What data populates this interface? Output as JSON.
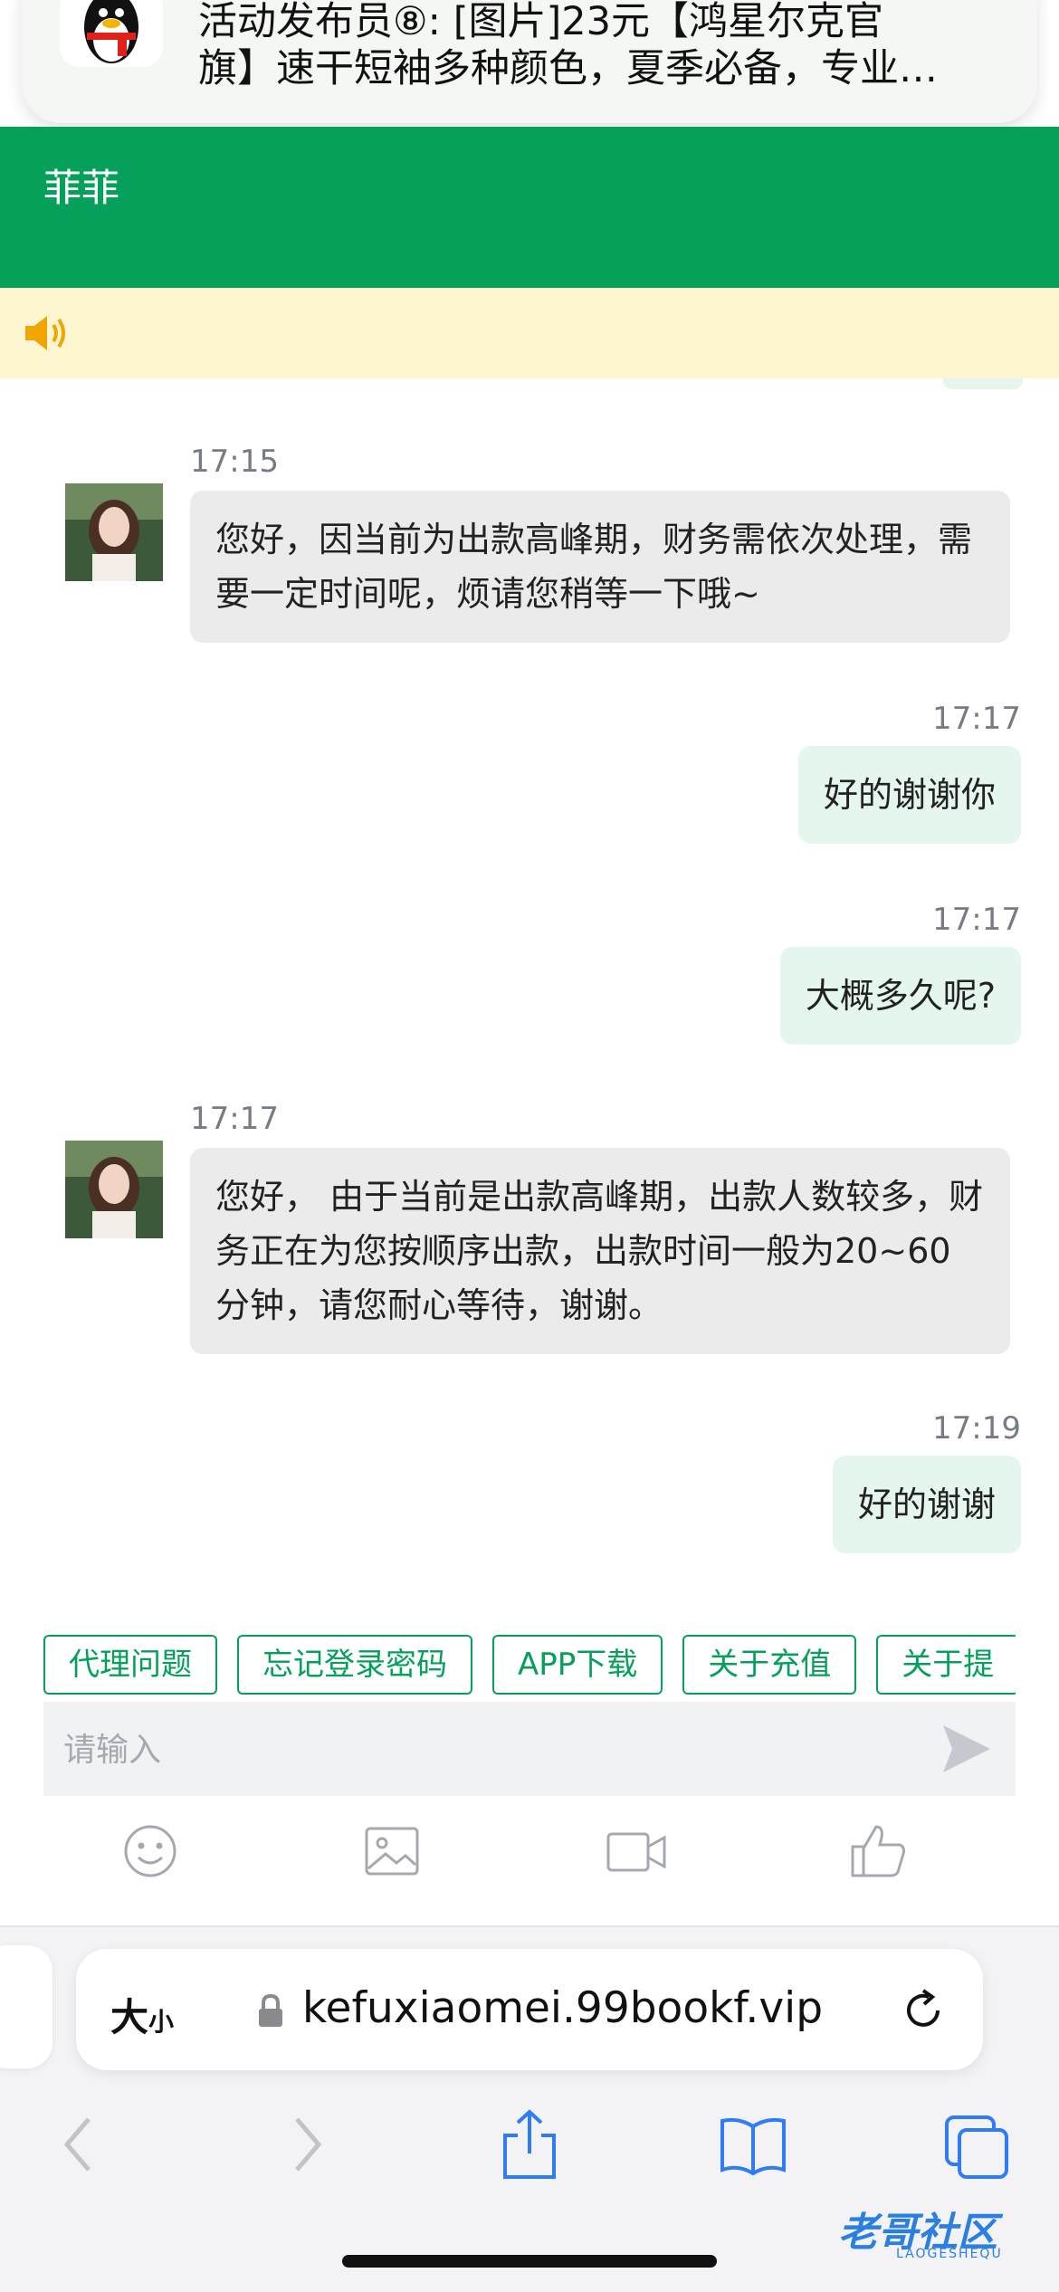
{
  "notification": {
    "line1": "活动发布员⑧: [图片]23元【鸿星尔克官",
    "line2": "旗】速干短袖多种颜色，夏季必备，专业…",
    "app_icon": "qq-penguin-icon"
  },
  "header": {
    "title": "菲菲"
  },
  "notice": {
    "icon": "speaker-icon"
  },
  "messages": [
    {
      "side": "left",
      "time": "17:15",
      "text": "您好，因当前为出款高峰期，财务需依次处理，需要一定时间呢，烦请您稍等一下哦~"
    },
    {
      "side": "right",
      "time": "17:17",
      "text": "好的谢谢你"
    },
    {
      "side": "right",
      "time": "17:17",
      "text": "大概多久呢?"
    },
    {
      "side": "left",
      "time": "17:17",
      "text": "您好， 由于当前是出款高峰期，出款人数较多，财务正在为您按顺序出款，出款时间一般为20~60分钟，请您耐心等待，谢谢。"
    },
    {
      "side": "right",
      "time": "17:19",
      "text": "好的谢谢"
    }
  ],
  "quick_tags": [
    "代理问题",
    "忘记登录密码",
    "APP下载",
    "关于充值",
    "关于提"
  ],
  "input": {
    "placeholder": "请输入",
    "value": ""
  },
  "toolbar": [
    "emoji-icon",
    "image-icon",
    "video-icon",
    "thumbs-up-icon"
  ],
  "browser": {
    "aa_label": "大",
    "aa_small": "小",
    "url": "kefuxiaomei.99bookf.vip"
  },
  "watermark": {
    "text": "老哥社区",
    "sub": "LAOGESHEQU"
  },
  "colors": {
    "brand_green": "#05a05a",
    "notice_bg": "#fdf6d0",
    "self_bubble": "#e4f6ee",
    "other_bubble": "#ebebeb"
  }
}
